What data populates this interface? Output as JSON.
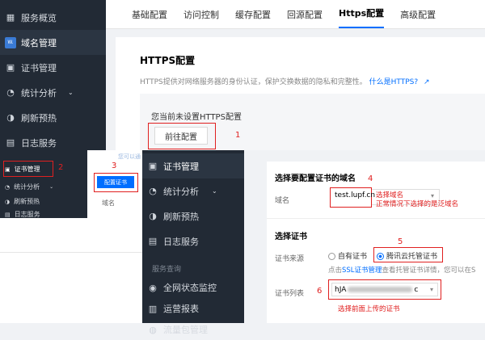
{
  "top_sidebar": {
    "items": [
      {
        "label": "服务概览",
        "icon": "grid-icon"
      },
      {
        "label": "域名管理",
        "icon": "www-icon"
      },
      {
        "label": "证书管理",
        "icon": "certificate-icon"
      },
      {
        "label": "统计分析",
        "icon": "chart-icon"
      },
      {
        "label": "刷新预热",
        "icon": "refresh-icon"
      },
      {
        "label": "日志服务",
        "icon": "log-icon"
      }
    ]
  },
  "tabs": [
    "基础配置",
    "访问控制",
    "缓存配置",
    "回源配置",
    "Https配置",
    "高级配置"
  ],
  "https_panel": {
    "title": "HTTPS配置",
    "desc": "HTTPS提供对网络服务器的身份认证，保护交换数据的隐私和完整性。",
    "link": "什么是HTTPS?",
    "notice": "您当前未设置HTTPS配置",
    "go_button": "前往配置",
    "step": "1"
  },
  "small_panel": {
    "items": [
      "证书管理",
      "统计分析",
      "刷新预热",
      "日志服务"
    ],
    "step2": "2",
    "step3": "3",
    "faint_text": "您可以通",
    "config_button": "配置证书",
    "col_header": "域名"
  },
  "mid_sidebar": {
    "items": [
      "证书管理",
      "统计分析",
      "刷新预热",
      "日志服务"
    ],
    "section": "服务查询",
    "items2": [
      "全网状态监控",
      "运营报表",
      "流量包管理"
    ]
  },
  "cert_form": {
    "domain_title": "选择要配置证书的域名",
    "step4": "4",
    "domain_label": "域名",
    "domain_value": "test.lupf.cn",
    "domain_note1": "选择域名",
    "domain_note2": "正常情况下选择的是泛域名",
    "cert_title": "选择证书",
    "source_label": "证书来源",
    "opt_own": "自有证书",
    "opt_hosted": "腾讯云托管证书",
    "step5": "5",
    "hint_prefix": "点击",
    "hint_link": "SSL证书管理",
    "hint_suffix": "查看托管证书详情，您可以在S",
    "list_label": "证书列表",
    "step6": "6",
    "list_value": "hJA",
    "list_value_tail": "c",
    "list_note": "选择前面上传的证书"
  }
}
